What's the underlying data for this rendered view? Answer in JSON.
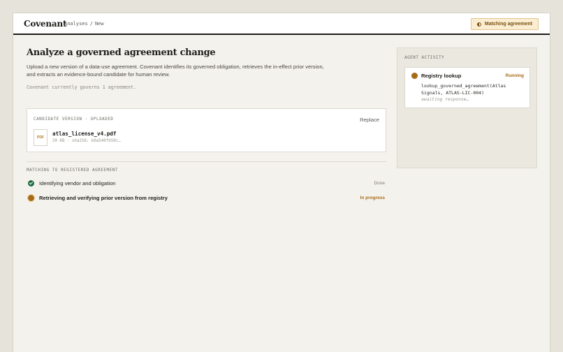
{
  "header": {
    "brand": "Covenant",
    "breadcrumb": [
      "Analyses",
      "New"
    ],
    "breadcrumb_sep": "/",
    "status_pill": "Matching agreement"
  },
  "main": {
    "title": "Analyze a governed agreement change",
    "description": "Upload a new version of a data-use agreement. Covenant identifies its governed obligation, retrieves the in-effect prior version, and extracts an evidence-bound candidate for human review.",
    "governs_note": "Covenant currently governs 1 agreement."
  },
  "candidate": {
    "label": "CANDIDATE VERSION · UPLOADED",
    "replace_label": "Replace",
    "file_type": "PDF",
    "file_name": "atlas_license_v4.pdf",
    "file_meta": "20 KB · sha256: b0a540fb50c…"
  },
  "matching": {
    "label": "MATCHING TO REGISTERED AGREEMENT",
    "steps": [
      {
        "text": "Identifying vendor and obligation",
        "status": "Done"
      },
      {
        "text": "Retrieving and verifying prior version from registry",
        "status": "In progress"
      }
    ]
  },
  "agent": {
    "label": "AGENT ACTIVITY",
    "title": "Registry lookup",
    "status": "Running",
    "call": "lookup_governed_agreement(Atlas Signals, ATLAS-LIC-004)",
    "awaiting": "awaiting response…"
  },
  "colors": {
    "accent": "#a76a17",
    "done": "#1f6b40",
    "background": "#f4f2ed"
  }
}
